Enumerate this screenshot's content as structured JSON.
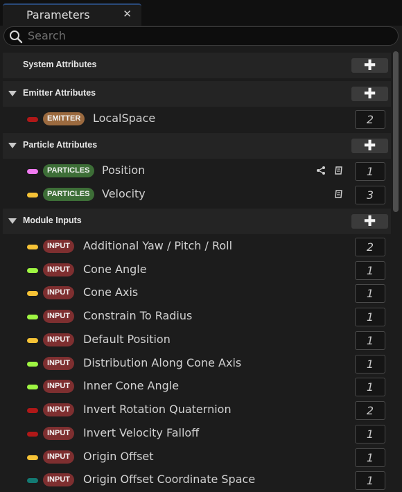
{
  "window": {
    "tab_title": "Parameters",
    "close_glyph": "✕"
  },
  "search": {
    "placeholder": "Search"
  },
  "add_glyph": "✚",
  "sections": {
    "system": {
      "label": "System Attributes"
    },
    "emitter": {
      "label": "Emitter Attributes"
    },
    "particle": {
      "label": "Particle Attributes"
    },
    "module": {
      "label": "Module Inputs"
    }
  },
  "emitter_rows": [
    {
      "tag": "EMITTER",
      "name": "LocalSpace",
      "count": "2",
      "pin_color": "#b01818"
    }
  ],
  "particle_rows": [
    {
      "tag": "PARTICLES",
      "name": "Position",
      "count": "1",
      "pin_color": "#f07af0",
      "icons": [
        "share-icon",
        "book-icon"
      ]
    },
    {
      "tag": "PARTICLES",
      "name": "Velocity",
      "count": "3",
      "pin_color": "#f5c236",
      "icons": [
        "book-icon"
      ]
    }
  ],
  "module_rows": [
    {
      "tag": "INPUT",
      "name": "Additional Yaw / Pitch / Roll",
      "count": "2",
      "pin_color": "#f5c236"
    },
    {
      "tag": "INPUT",
      "name": "Cone Angle",
      "count": "1",
      "pin_color": "#9ef542"
    },
    {
      "tag": "INPUT",
      "name": "Cone Axis",
      "count": "1",
      "pin_color": "#f5c236"
    },
    {
      "tag": "INPUT",
      "name": "Constrain To Radius",
      "count": "1",
      "pin_color": "#9ef542"
    },
    {
      "tag": "INPUT",
      "name": "Default Position",
      "count": "1",
      "pin_color": "#f5c236"
    },
    {
      "tag": "INPUT",
      "name": "Distribution Along Cone Axis",
      "count": "1",
      "pin_color": "#9ef542"
    },
    {
      "tag": "INPUT",
      "name": "Inner Cone Angle",
      "count": "1",
      "pin_color": "#9ef542"
    },
    {
      "tag": "INPUT",
      "name": "Invert Rotation Quaternion",
      "count": "2",
      "pin_color": "#b01818"
    },
    {
      "tag": "INPUT",
      "name": "Invert Velocity Falloff",
      "count": "1",
      "pin_color": "#b01818"
    },
    {
      "tag": "INPUT",
      "name": "Origin Offset",
      "count": "1",
      "pin_color": "#f5c236"
    },
    {
      "tag": "INPUT",
      "name": "Origin Offset Coordinate Space",
      "count": "1",
      "pin_color": "#137a73"
    }
  ]
}
